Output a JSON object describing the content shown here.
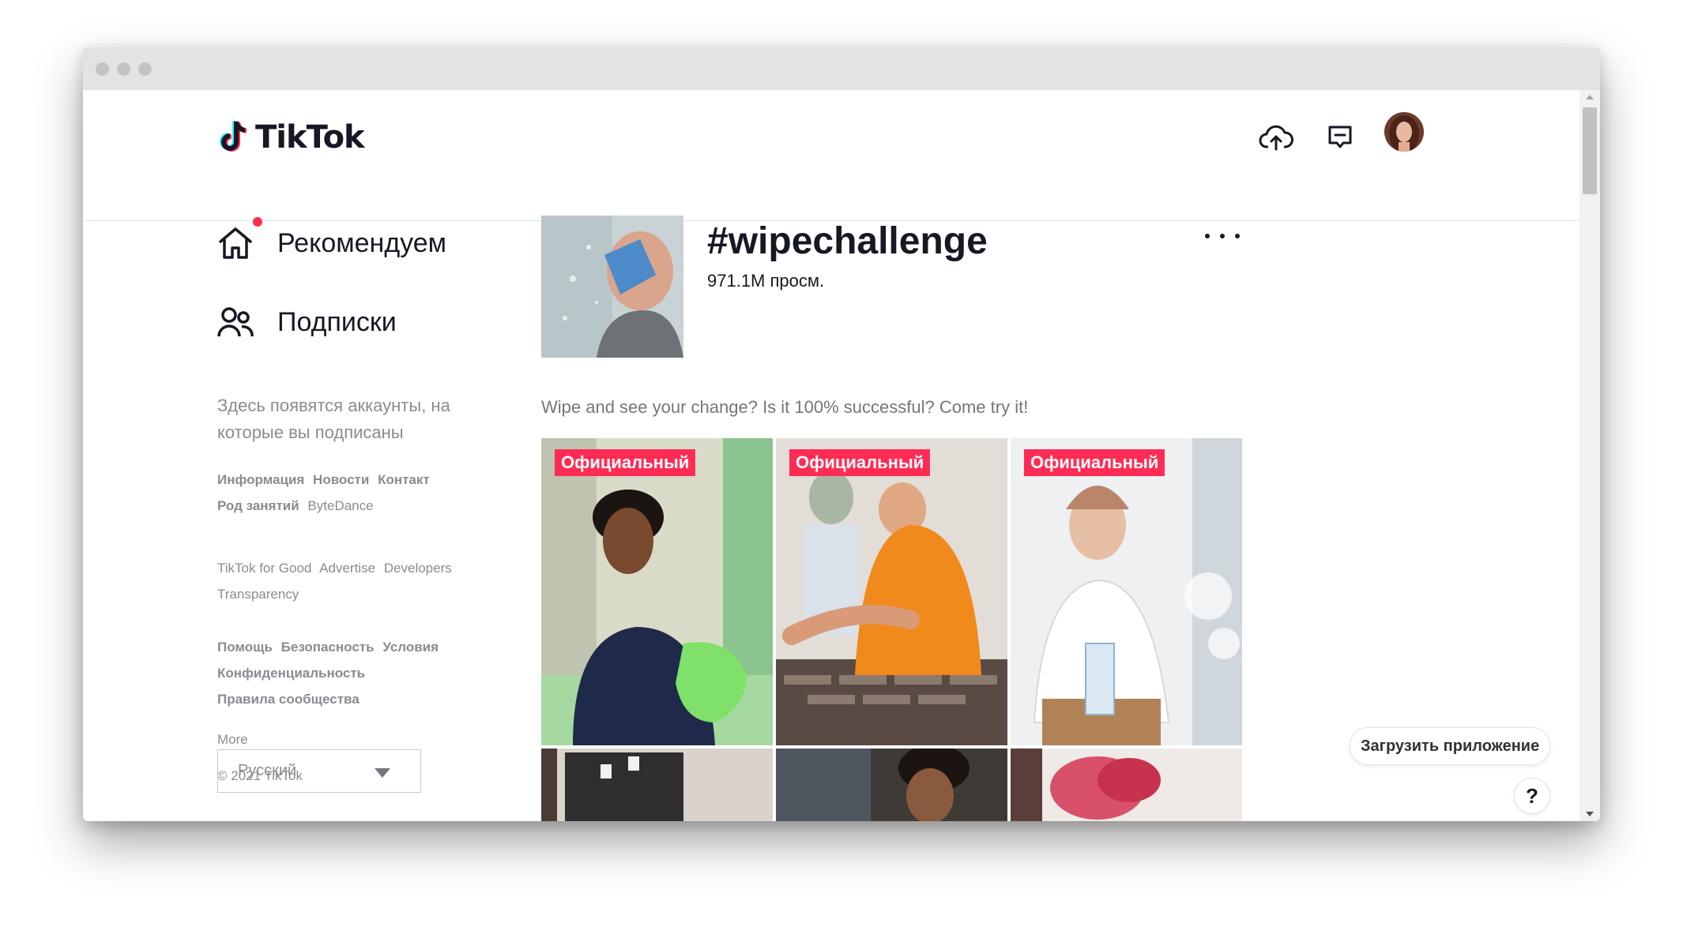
{
  "app": {
    "logo_text": "TikTok"
  },
  "header": {
    "icons": [
      "upload-icon",
      "inbox-icon",
      "avatar"
    ]
  },
  "sidebar": {
    "nav": [
      {
        "label": "Рекомендуем",
        "icon": "home-icon",
        "has_notification": true
      },
      {
        "label": "Подписки",
        "icon": "following-icon"
      }
    ],
    "following_note": "Здесь появятся аккаунты, на которые вы подписаны",
    "links_1": [
      "Информация",
      "Новости",
      "Контакт",
      "Род занятий",
      "ByteDance"
    ],
    "links_2": [
      "TikTok for Good",
      "Advertise",
      "Developers",
      "Transparency"
    ],
    "links_3": [
      "Помощь",
      "Безопасность",
      "Условия",
      "Конфиденциальность",
      "Правила сообщества"
    ],
    "more": "More",
    "copyright": "© 2021 TikTok",
    "language": "Русский"
  },
  "challenge": {
    "title": "#wipechallenge",
    "views": "971.1M просм.",
    "description": "Wipe and see your change? Is it 100% successful? Come try it!"
  },
  "videos": [
    {
      "badge": "Официальный"
    },
    {
      "badge": "Официальный"
    },
    {
      "badge": "Официальный"
    },
    {
      "badge": ""
    },
    {
      "badge": ""
    },
    {
      "badge": ""
    }
  ],
  "floating": {
    "get_app": "Загрузить приложение",
    "help": "?"
  },
  "colors": {
    "accent": "#fe2c55",
    "text": "#161823",
    "muted": "#8a8b91"
  }
}
